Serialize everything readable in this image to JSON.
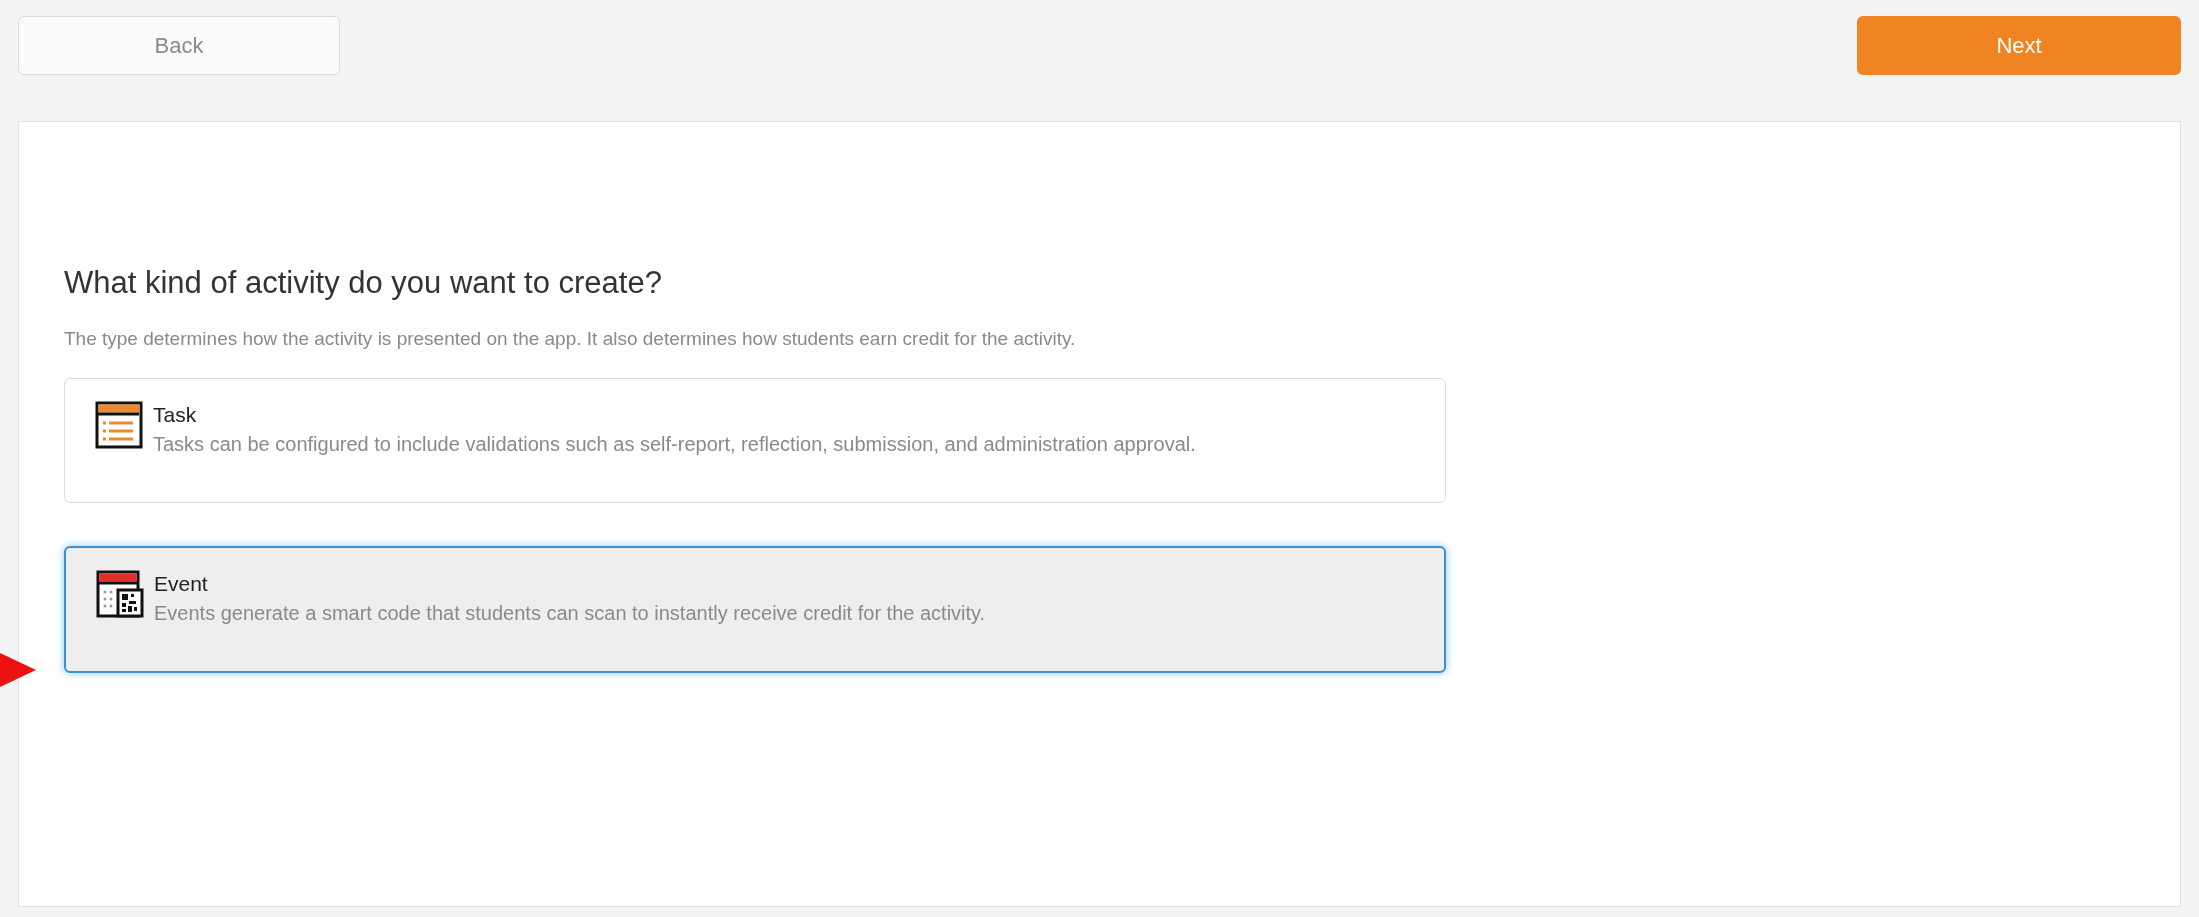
{
  "toolbar": {
    "back": "Back",
    "next": "Next"
  },
  "heading": "What kind of activity do you want to create?",
  "description": "The type determines how the activity is presented on the app. It also determines how students earn credit for the activity.",
  "options": [
    {
      "kind": "task",
      "title": "Task",
      "text": "Tasks can be configured to include validations such as self-report, reflection, submission, and administration approval.",
      "selected": false
    },
    {
      "kind": "event",
      "title": "Event",
      "text": "Events generate a smart code that students can scan to instantly receive credit for the activity.",
      "selected": true
    }
  ]
}
